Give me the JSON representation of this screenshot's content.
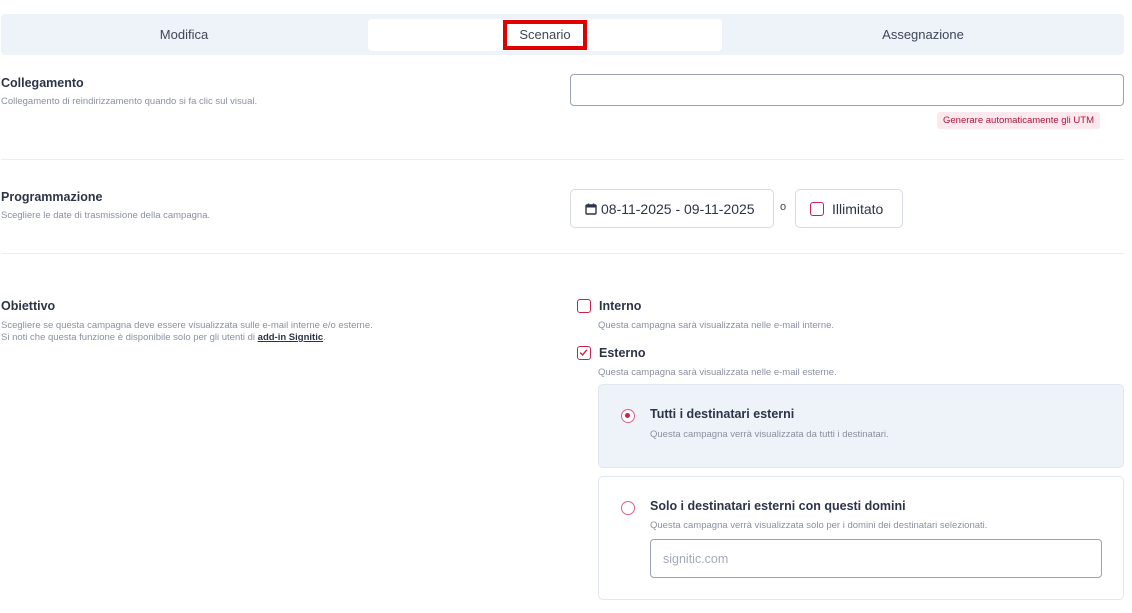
{
  "tabs": [
    {
      "label": "Modifica"
    },
    {
      "label": "Scenario"
    },
    {
      "label": "Assegnazione"
    }
  ],
  "link_section": {
    "title": "Collegamento",
    "description": "Collegamento di reindirizzamento quando si fa clic sul visual.",
    "input_value": "",
    "utm_button": "Generare automaticamente gli UTM"
  },
  "schedule_section": {
    "title": "Programmazione",
    "description": "Scegliere le date di trasmissione della campagna.",
    "date_range": "08-11-2025 - 09-11-2025",
    "or_text": "o",
    "unlimited_label": "Illimitato",
    "unlimited_checked": false
  },
  "objective_section": {
    "title": "Obiettivo",
    "description_line1": "Scegliere se questa campagna deve essere visualizzata sulle e-mail interne e/o esterne.",
    "description_line2_prefix": "Si noti che questa funzione è disponibile solo per gli utenti di ",
    "description_link": "add-in Signitic",
    "description_suffix": ".",
    "internal": {
      "label": "Interno",
      "description": "Questa campagna sarà visualizzata nelle e-mail interne.",
      "checked": false
    },
    "external": {
      "label": "Esterno",
      "description": "Questa campagna sarà visualizzata nelle e-mail esterne.",
      "checked": true
    },
    "all_recipients": {
      "title": "Tutti i destinatari esterni",
      "description": "Questa campagna verrà visualizzata da tutti i destinatari.",
      "selected": true
    },
    "domain_recipients": {
      "title": "Solo i destinatari esterni con questi domini",
      "description": "Questa campagna verrà visualizzata solo per i domini dei destinatari selezionati.",
      "placeholder": "signitic.com",
      "selected": false
    }
  },
  "colors": {
    "accent": "#c8224f",
    "highlight_box": "#e00000",
    "card_bg": "#eef2f9"
  }
}
